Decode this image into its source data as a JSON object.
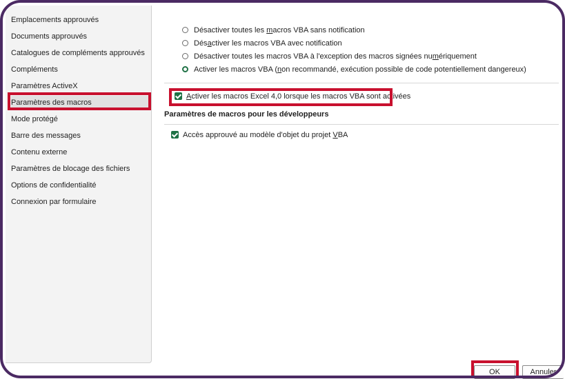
{
  "sidebar": {
    "items": [
      {
        "label": "Emplacements approuvés"
      },
      {
        "label": "Documents approuvés"
      },
      {
        "label": "Catalogues de compléments approuvés"
      },
      {
        "label": "Compléments"
      },
      {
        "label": "Paramètres ActiveX"
      },
      {
        "label": "Paramètres des macros",
        "selected": true
      },
      {
        "label": "Mode protégé"
      },
      {
        "label": "Barre des messages"
      },
      {
        "label": "Contenu externe"
      },
      {
        "label": "Paramètres de blocage des fichiers"
      },
      {
        "label": "Options de confidentialité"
      },
      {
        "label": "Connexion par formulaire"
      }
    ]
  },
  "macro_settings": {
    "options": [
      {
        "pre": "Désactiver toutes les ",
        "ul": "m",
        "post": "acros VBA sans notification",
        "checked": false
      },
      {
        "pre": "Dés",
        "ul": "a",
        "post": "ctiver les macros VBA avec notification",
        "checked": false
      },
      {
        "pre": "Désactiver toutes les macros VBA à l'exception des macros signées nu",
        "ul": "m",
        "post": "ériquement",
        "checked": false
      },
      {
        "pre": "Activer les macros VBA (",
        "ul": "n",
        "post": "on recommandé, exécution possible de code potentiellement dangereux)",
        "checked": true
      }
    ],
    "excel4": {
      "ul": "A",
      "post": "ctiver les macros Excel 4,0 lorsque les macros VBA sont activées",
      "checked": true
    }
  },
  "developer": {
    "title": "Paramètres de macros pour les développeurs",
    "vba_access": {
      "pre": "Accès approuvé au modèle d'objet du projet ",
      "ul": "V",
      "post": "BA",
      "checked": true
    }
  },
  "buttons": {
    "ok": "OK",
    "cancel": "Annuler"
  },
  "colors": {
    "frame": "#4b2a63",
    "highlight": "#c8102e",
    "accent": "#1e7145"
  }
}
